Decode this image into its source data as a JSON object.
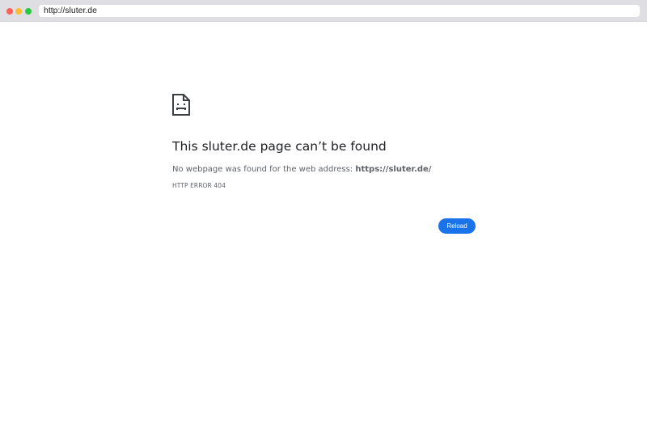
{
  "browser": {
    "address_bar": "http://sluter.de"
  },
  "error_page": {
    "icon": "sad-page-icon",
    "heading": "This sluter.de page can’t be found",
    "description_prefix": "No webpage was found for the web address: ",
    "description_address": "https://sluter.de/",
    "error_code": "HTTP ERROR 404",
    "reload_label": "Reload"
  },
  "colors": {
    "accent": "#1a73e8",
    "titlebar": "#dedee3",
    "close": "#fe5f57",
    "minimize": "#febc2e",
    "maximize": "#28c840"
  }
}
